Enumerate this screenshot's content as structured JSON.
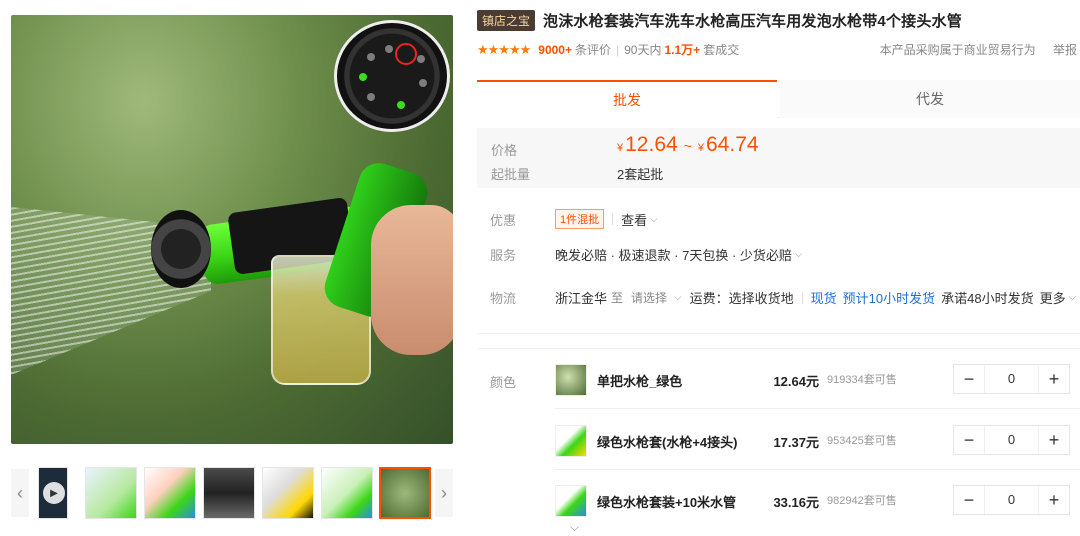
{
  "gallery": {
    "thumbnails": [
      "video",
      "img1",
      "img2",
      "img3",
      "img4",
      "img5",
      "img6"
    ],
    "active_index": 6,
    "prev_glyph": "‹",
    "next_glyph": "›"
  },
  "product": {
    "shop_tag": "镇店之宝",
    "title": "泡沫水枪套装汽车洗车水枪高压汽车用发泡水枪带4个接头水管",
    "rating_stars": "★★★★★",
    "review_count": "9000+",
    "review_label": "条评价",
    "sold_prefix": "90天内",
    "sold_count": "1.1万+",
    "sold_label": "套成交",
    "notice": "本产品采购属于商业贸易行为",
    "report": "举报"
  },
  "tabs": [
    {
      "label": "批发"
    },
    {
      "label": "代发"
    }
  ],
  "pricing": {
    "price_label": "价格",
    "currency": "¥",
    "price_min": "12.64",
    "tilde": "~",
    "price_max": "64.74",
    "moq_label": "起批量",
    "moq_value": "2套起批"
  },
  "offers": {
    "label": "优惠",
    "tag": "1件混批",
    "link": "查看"
  },
  "service": {
    "label": "服务",
    "text": "晚发必赔 · 极速退款 · 7天包换 · 少货必赔"
  },
  "logistics": {
    "label": "物流",
    "from": "浙江金华",
    "to": "至",
    "select_placeholder": "请选择",
    "freight": "运费：选择收货地",
    "instock": "现货",
    "eta": "预计10小时发货",
    "promise": "承诺48小时发货",
    "more": "更多"
  },
  "color": {
    "label": "颜色",
    "skus": [
      {
        "name": "单把水枪_绿色",
        "price": "12.64元",
        "stock": "919334套可售",
        "qty": "0"
      },
      {
        "name": "绿色水枪套(水枪+4接头)",
        "price": "17.37元",
        "stock": "953425套可售",
        "qty": "0"
      },
      {
        "name": "绿色水枪套装+10米水管",
        "price": "33.16元",
        "stock": "982942套可售",
        "qty": "0"
      }
    ],
    "minus": "−",
    "plus": "+"
  },
  "colors": {
    "accent": "#ff5000",
    "shop_tag_bg": "#4a3c33",
    "blue_link": "#1e6fd9"
  }
}
